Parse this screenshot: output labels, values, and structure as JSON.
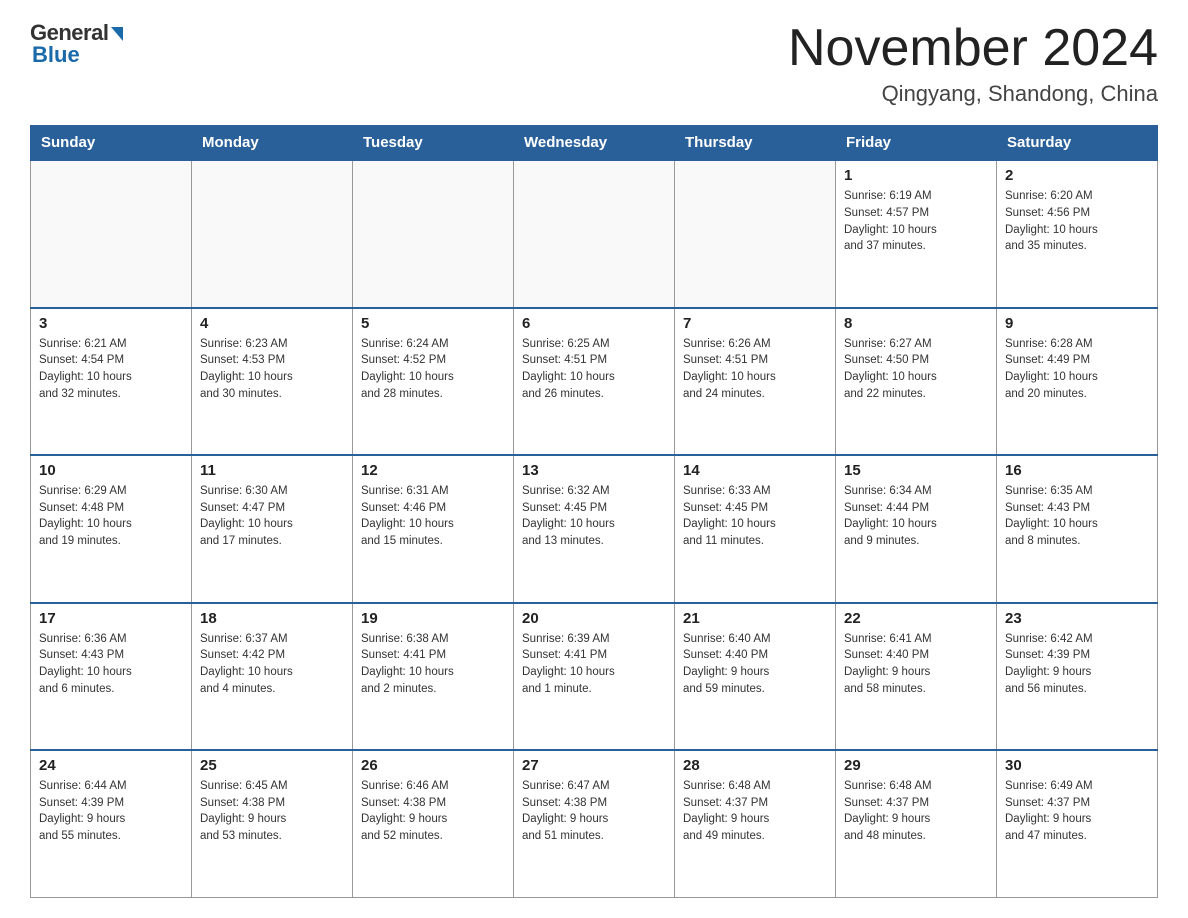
{
  "header": {
    "logo_general": "General",
    "logo_blue": "Blue",
    "month_title": "November 2024",
    "location": "Qingyang, Shandong, China"
  },
  "days_of_week": [
    "Sunday",
    "Monday",
    "Tuesday",
    "Wednesday",
    "Thursday",
    "Friday",
    "Saturday"
  ],
  "weeks": [
    [
      {
        "day": "",
        "info": ""
      },
      {
        "day": "",
        "info": ""
      },
      {
        "day": "",
        "info": ""
      },
      {
        "day": "",
        "info": ""
      },
      {
        "day": "",
        "info": ""
      },
      {
        "day": "1",
        "info": "Sunrise: 6:19 AM\nSunset: 4:57 PM\nDaylight: 10 hours\nand 37 minutes."
      },
      {
        "day": "2",
        "info": "Sunrise: 6:20 AM\nSunset: 4:56 PM\nDaylight: 10 hours\nand 35 minutes."
      }
    ],
    [
      {
        "day": "3",
        "info": "Sunrise: 6:21 AM\nSunset: 4:54 PM\nDaylight: 10 hours\nand 32 minutes."
      },
      {
        "day": "4",
        "info": "Sunrise: 6:23 AM\nSunset: 4:53 PM\nDaylight: 10 hours\nand 30 minutes."
      },
      {
        "day": "5",
        "info": "Sunrise: 6:24 AM\nSunset: 4:52 PM\nDaylight: 10 hours\nand 28 minutes."
      },
      {
        "day": "6",
        "info": "Sunrise: 6:25 AM\nSunset: 4:51 PM\nDaylight: 10 hours\nand 26 minutes."
      },
      {
        "day": "7",
        "info": "Sunrise: 6:26 AM\nSunset: 4:51 PM\nDaylight: 10 hours\nand 24 minutes."
      },
      {
        "day": "8",
        "info": "Sunrise: 6:27 AM\nSunset: 4:50 PM\nDaylight: 10 hours\nand 22 minutes."
      },
      {
        "day": "9",
        "info": "Sunrise: 6:28 AM\nSunset: 4:49 PM\nDaylight: 10 hours\nand 20 minutes."
      }
    ],
    [
      {
        "day": "10",
        "info": "Sunrise: 6:29 AM\nSunset: 4:48 PM\nDaylight: 10 hours\nand 19 minutes."
      },
      {
        "day": "11",
        "info": "Sunrise: 6:30 AM\nSunset: 4:47 PM\nDaylight: 10 hours\nand 17 minutes."
      },
      {
        "day": "12",
        "info": "Sunrise: 6:31 AM\nSunset: 4:46 PM\nDaylight: 10 hours\nand 15 minutes."
      },
      {
        "day": "13",
        "info": "Sunrise: 6:32 AM\nSunset: 4:45 PM\nDaylight: 10 hours\nand 13 minutes."
      },
      {
        "day": "14",
        "info": "Sunrise: 6:33 AM\nSunset: 4:45 PM\nDaylight: 10 hours\nand 11 minutes."
      },
      {
        "day": "15",
        "info": "Sunrise: 6:34 AM\nSunset: 4:44 PM\nDaylight: 10 hours\nand 9 minutes."
      },
      {
        "day": "16",
        "info": "Sunrise: 6:35 AM\nSunset: 4:43 PM\nDaylight: 10 hours\nand 8 minutes."
      }
    ],
    [
      {
        "day": "17",
        "info": "Sunrise: 6:36 AM\nSunset: 4:43 PM\nDaylight: 10 hours\nand 6 minutes."
      },
      {
        "day": "18",
        "info": "Sunrise: 6:37 AM\nSunset: 4:42 PM\nDaylight: 10 hours\nand 4 minutes."
      },
      {
        "day": "19",
        "info": "Sunrise: 6:38 AM\nSunset: 4:41 PM\nDaylight: 10 hours\nand 2 minutes."
      },
      {
        "day": "20",
        "info": "Sunrise: 6:39 AM\nSunset: 4:41 PM\nDaylight: 10 hours\nand 1 minute."
      },
      {
        "day": "21",
        "info": "Sunrise: 6:40 AM\nSunset: 4:40 PM\nDaylight: 9 hours\nand 59 minutes."
      },
      {
        "day": "22",
        "info": "Sunrise: 6:41 AM\nSunset: 4:40 PM\nDaylight: 9 hours\nand 58 minutes."
      },
      {
        "day": "23",
        "info": "Sunrise: 6:42 AM\nSunset: 4:39 PM\nDaylight: 9 hours\nand 56 minutes."
      }
    ],
    [
      {
        "day": "24",
        "info": "Sunrise: 6:44 AM\nSunset: 4:39 PM\nDaylight: 9 hours\nand 55 minutes."
      },
      {
        "day": "25",
        "info": "Sunrise: 6:45 AM\nSunset: 4:38 PM\nDaylight: 9 hours\nand 53 minutes."
      },
      {
        "day": "26",
        "info": "Sunrise: 6:46 AM\nSunset: 4:38 PM\nDaylight: 9 hours\nand 52 minutes."
      },
      {
        "day": "27",
        "info": "Sunrise: 6:47 AM\nSunset: 4:38 PM\nDaylight: 9 hours\nand 51 minutes."
      },
      {
        "day": "28",
        "info": "Sunrise: 6:48 AM\nSunset: 4:37 PM\nDaylight: 9 hours\nand 49 minutes."
      },
      {
        "day": "29",
        "info": "Sunrise: 6:48 AM\nSunset: 4:37 PM\nDaylight: 9 hours\nand 48 minutes."
      },
      {
        "day": "30",
        "info": "Sunrise: 6:49 AM\nSunset: 4:37 PM\nDaylight: 9 hours\nand 47 minutes."
      }
    ]
  ]
}
